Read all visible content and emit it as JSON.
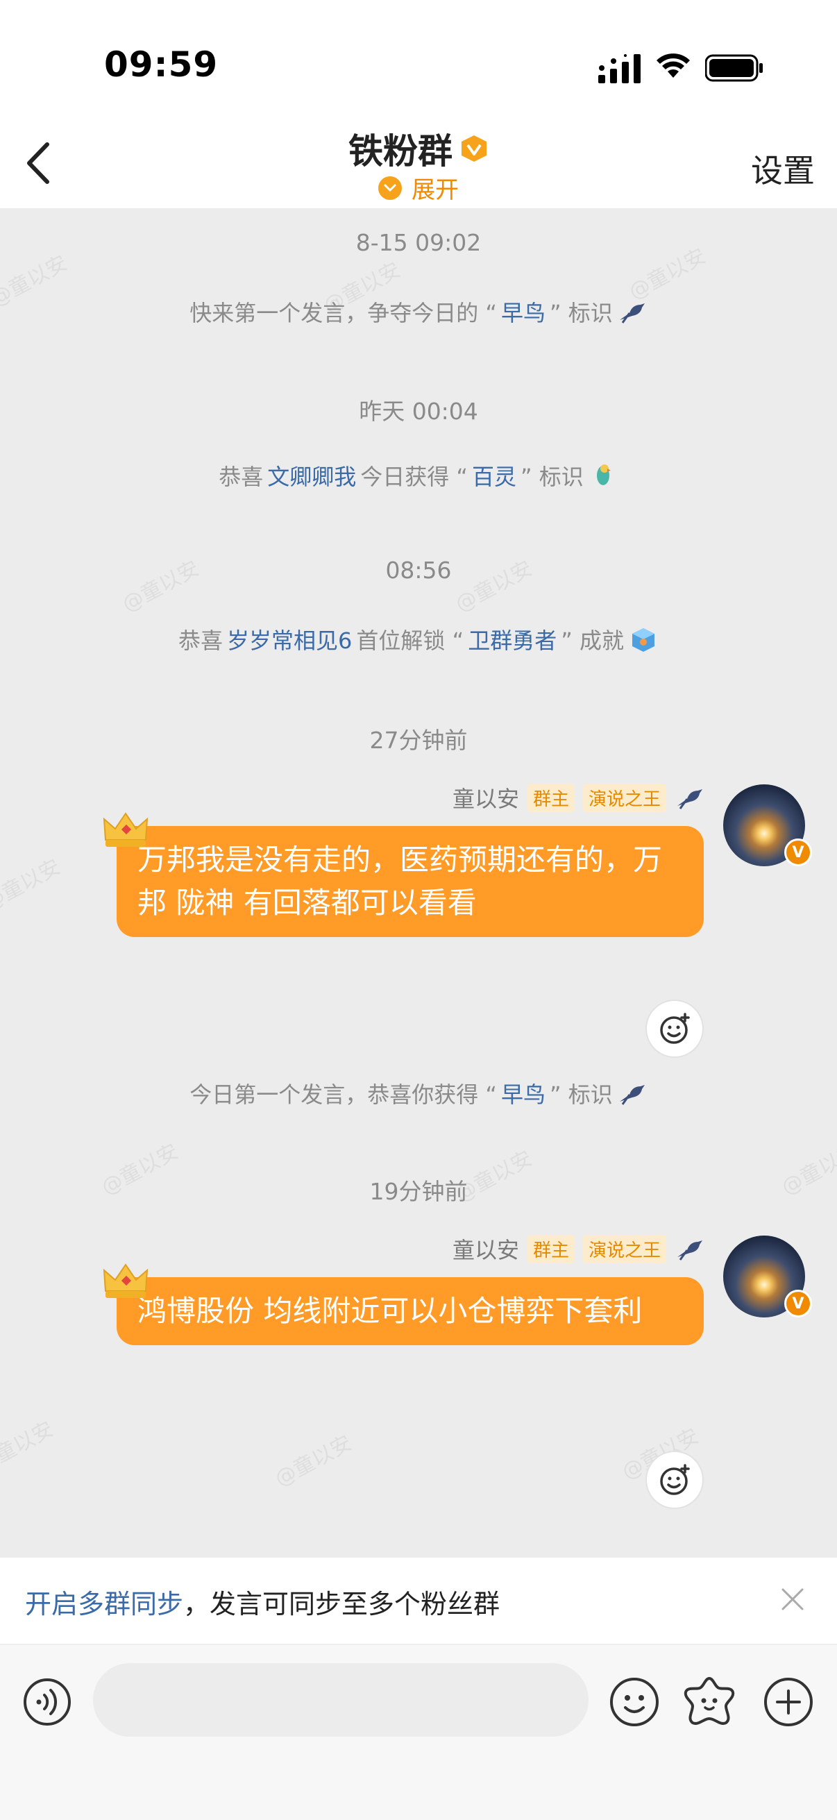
{
  "status": {
    "time": "09:59"
  },
  "header": {
    "title": "铁粉群",
    "expand_label": "展开",
    "settings_label": "设置"
  },
  "watermark_text": "@童以安",
  "timeline": {
    "ts1": "8-15 09:02",
    "sys1": {
      "prefix": "快来第一个发言，争夺今日的 “",
      "highlight": "早鸟",
      "suffix": "” 标识"
    },
    "ts2": "昨天 00:04",
    "sys2": {
      "prefix": "恭喜",
      "name": "文卿卿我",
      "middle": "今日获得 “",
      "highlight": "百灵",
      "suffix": "” 标识"
    },
    "ts3": "08:56",
    "sys3": {
      "prefix": "恭喜 ",
      "name": "岁岁常相见6",
      "middle": " 首位解锁 “",
      "highlight": "卫群勇者",
      "suffix": "” 成就"
    },
    "ts4": "27分钟前",
    "ts5": "19分钟前",
    "sys4": {
      "prefix": "今日第一个发言，恭喜你获得 “",
      "highlight": "早鸟",
      "suffix": "” 标识"
    }
  },
  "messages": [
    {
      "sender": "童以安",
      "tag1": "群主",
      "tag2": "演说之王",
      "text": "万邦我是没有走的，医药预期还有的，万邦 陇神 有回落都可以看看"
    },
    {
      "sender": "童以安",
      "tag1": "群主",
      "tag2": "演说之王",
      "text": "鸿博股份 均线附近可以小仓博弈下套利"
    }
  ],
  "sync_banner": {
    "link": "开启多群同步",
    "text": "，发言可同步至多个粉丝群"
  },
  "input": {
    "placeholder": ""
  },
  "colors": {
    "accent": "#ff9b26",
    "link": "#3a6aa8",
    "chat_bg": "#ececec"
  }
}
